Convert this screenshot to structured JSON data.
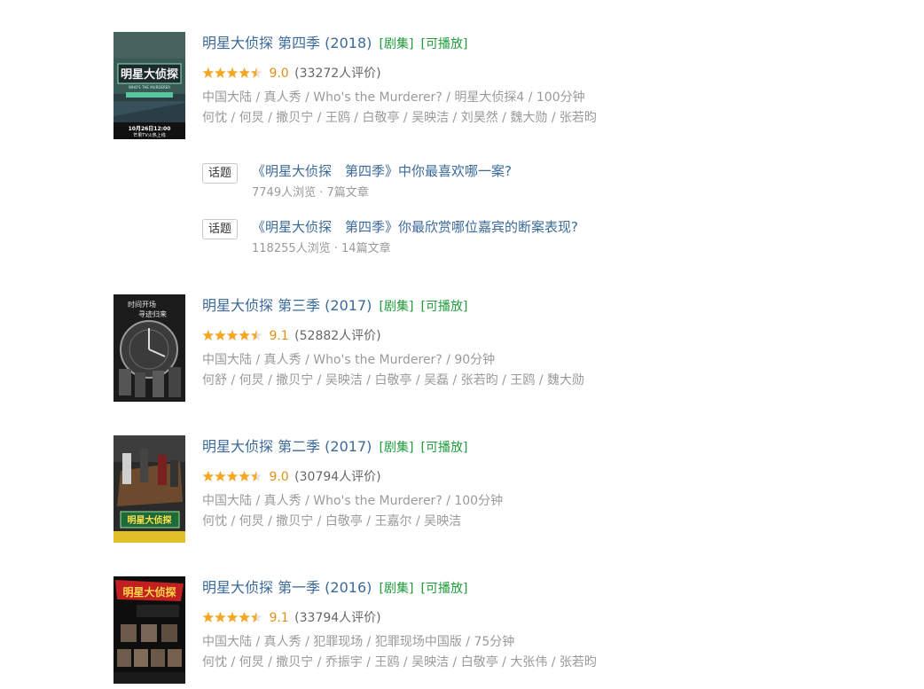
{
  "colors": {
    "title": "#3b6a9a",
    "tag": "#1f9b3a",
    "score": "#e09015",
    "star": "#f5a623",
    "meta": "#9a9a9a"
  },
  "items": [
    {
      "title": "明星大侦探 第四季 (2018)",
      "tag_series": "[剧集]",
      "tag_play": "[可播放]",
      "rating_stars": 4.5,
      "score": "9.0",
      "rating_count": "(33272人评价)",
      "meta": "中国大陆 / 真人秀 / Who's the Murderer? / 明星大侦探4 / 100分钟",
      "cast": "何忱 / 何炅 / 撒贝宁 / 王鸥 / 白敬亭 / 吴映洁 / 刘昊然 / 魏大勋 / 张若昀",
      "poster_text": [
        "明星大侦探",
        "WHO'S THE MURDERER",
        "10月26日12:00",
        "芒果TV火热上线"
      ],
      "topics": [
        {
          "badge": "话题",
          "title": "《明星大侦探　第四季》中你最喜欢哪一案?",
          "meta": "7749人浏览 · 7篇文章"
        },
        {
          "badge": "话题",
          "title": "《明星大侦探　第四季》你最欣赏哪位嘉宾的断案表现?",
          "meta": "118255人浏览 · 14篇文章"
        }
      ]
    },
    {
      "title": "明星大侦探 第三季 (2017)",
      "tag_series": "[剧集]",
      "tag_play": "[可播放]",
      "rating_stars": 4.5,
      "score": "9.1",
      "rating_count": "(52882人评价)",
      "meta": "中国大陆 / 真人秀 / Who's the Murderer? / 90分钟",
      "cast": "何舒 / 何炅 / 撒贝宁 / 吴映洁 / 白敬亭 / 吴磊 / 张若昀 / 王鸥 / 魏大勋",
      "poster_text": [
        "时间开场",
        "寻迹归来"
      ]
    },
    {
      "title": "明星大侦探 第二季 (2017)",
      "tag_series": "[剧集]",
      "tag_play": "[可播放]",
      "rating_stars": 4.5,
      "score": "9.0",
      "rating_count": "(30794人评价)",
      "meta": "中国大陆 / 真人秀 / Who's the Murderer? / 100分钟",
      "cast": "何忱 / 何炅 / 撒贝宁 / 白敬亭 / 王嘉尔 / 吴映洁",
      "poster_text": [
        "明星大侦探"
      ]
    },
    {
      "title": "明星大侦探 第一季 (2016)",
      "tag_series": "[剧集]",
      "tag_play": "[可播放]",
      "rating_stars": 4.5,
      "score": "9.1",
      "rating_count": "(33794人评价)",
      "meta": "中国大陆 / 真人秀 / 犯罪现场 / 犯罪现场中国版 / 75分钟",
      "cast": "何忱 / 何炅 / 撒贝宁 / 乔振宇 / 王鸥 / 吴映洁 / 白敬亭 / 大张伟 / 张若昀",
      "poster_text": [
        "明星大侦探"
      ]
    }
  ]
}
